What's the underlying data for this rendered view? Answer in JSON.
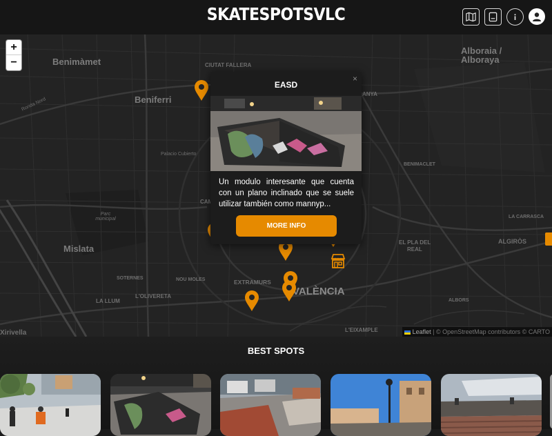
{
  "header": {
    "logo": "SKATESPOTSVLC",
    "icons": [
      "map-icon",
      "book-icon",
      "info-icon",
      "user-icon"
    ]
  },
  "map": {
    "zoom_in": "+",
    "zoom_out": "−",
    "labels": {
      "benimamet": "Benimàmet",
      "beniferri": "Beniferri",
      "alboraia": "Alboraia /",
      "alboraya": "Alboraya",
      "mislata": "Mislata",
      "valencia": "VALÈNCIA",
      "ciutat_fallera": "CIUTAT FALLERA",
      "extramurs": "EXTRAMURS",
      "la_llum": "LA LLUM",
      "soternes": "SOTERNES",
      "nou_moles": "NOU MOLES",
      "olivereta": "L'OLIVERETA",
      "el_pla_del_real": "EL PLA DEL",
      "real": "REAL",
      "algiros": "ALGIRÒS",
      "la_carrasca": "LA CARRASCA",
      "benimaclet": "BENIMACLET",
      "albors": "ALBORS",
      "eixample": "L'EIXAMPLE",
      "xirivella": "Xirivella",
      "parc_municipal": "Parc municipal",
      "pacino": "Palacio Cubierto",
      "ronda_nord": "Ronda Nord",
      "anya": "ANYA",
      "cam": "CAM"
    },
    "attribution": {
      "leaflet": "Leaflet",
      "rest": "| © OpenStreetMap contributors © CARTO"
    }
  },
  "popup": {
    "close": "×",
    "title": "EASD",
    "description": "Un modulo interesante que cuenta con un plano inclinado que se suele utilizar también como mannyp...",
    "button": "MORE INFO"
  },
  "best_spots": {
    "title": "BEST SPOTS",
    "cards": [
      "spot-photo-1",
      "spot-photo-2",
      "spot-photo-3",
      "spot-photo-4",
      "spot-photo-5"
    ]
  },
  "colors": {
    "accent": "#e68a00",
    "marker": "#e68a00",
    "background": "#1b1b1b"
  }
}
